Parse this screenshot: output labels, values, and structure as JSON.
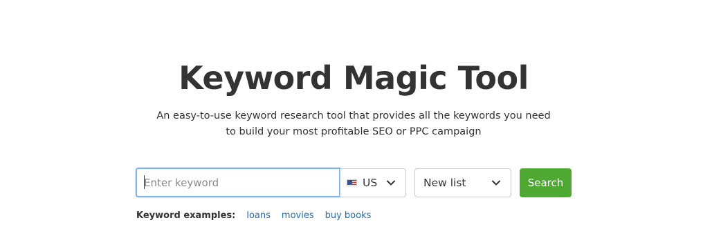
{
  "page": {
    "title": "Keyword Magic Tool",
    "subtitle_line1": "An easy-to-use keyword research tool that provides all the keywords you need",
    "subtitle_line2": "to build your most profitable SEO or PPC campaign"
  },
  "search": {
    "placeholder": "Enter keyword",
    "value": "",
    "database": {
      "selected": "US",
      "flag_icon": "us-flag-icon"
    },
    "list": {
      "selected": "New list"
    },
    "button_label": "Search"
  },
  "examples": {
    "label": "Keyword examples:",
    "items": [
      "loans",
      "movies",
      "buy books"
    ]
  },
  "colors": {
    "accent_green": "#4ea832",
    "link_blue": "#1f6fb5",
    "focus_blue": "#7db2e2",
    "text": "#333333"
  }
}
